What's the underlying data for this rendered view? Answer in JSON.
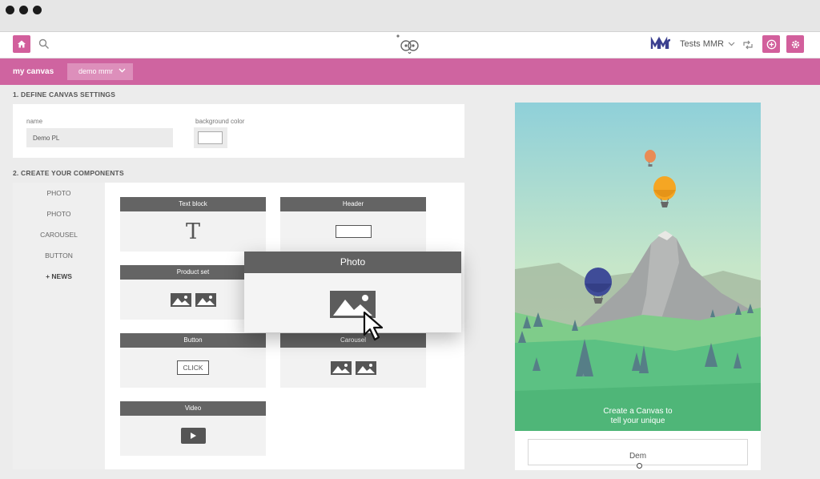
{
  "header": {
    "account_name": "Tests MMR"
  },
  "canvas_bar": {
    "title": "my canvas",
    "selected_canvas": "demo mmr"
  },
  "section1": {
    "title": "1. DEFINE CANVAS SETTINGS",
    "name_label": "name",
    "name_value": "Demo PL",
    "bg_label": "background color",
    "bg_value": "#ffffff"
  },
  "section2": {
    "title": "2. CREATE YOUR COMPONENTS",
    "menu": [
      "PHOTO",
      "PHOTO",
      "CAROUSEL",
      "BUTTON",
      "+ NEWS"
    ],
    "tiles": [
      {
        "label": "Text block",
        "glyph": "T"
      },
      {
        "label": "Header"
      },
      {
        "label": "Product set"
      },
      {
        "label": "Button",
        "button_text": "CLICK"
      },
      {
        "label": "Carousel"
      },
      {
        "label": "Video"
      }
    ],
    "dragging_tile": "Photo"
  },
  "preview": {
    "caption_line1": "Create a Canvas to",
    "caption_line2": "tell your unique",
    "input_text": "Dem"
  },
  "colors": {
    "brand_pink": "#cf64a0",
    "brand_pink_light": "#dd8fbb",
    "tile_header": "#646464",
    "sky_top": "#8fd0d9",
    "grass": "#5cc183"
  },
  "icons": [
    "home-icon",
    "search-icon",
    "owl-logo-icon",
    "mmr-logo-icon",
    "chevron-down-icon",
    "sync-icon",
    "add-circle-icon",
    "gear-icon",
    "image-icon",
    "play-icon",
    "cursor-icon"
  ]
}
